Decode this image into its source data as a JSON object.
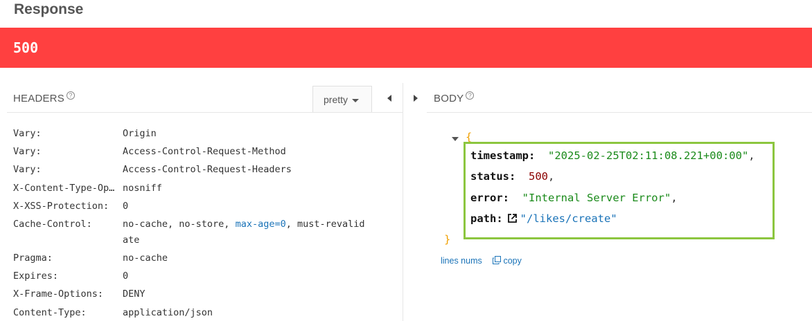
{
  "response": {
    "title": "Response",
    "status_code": "500"
  },
  "headers_panel": {
    "label": "HEADERS",
    "help_glyph": "?",
    "format_select": "pretty",
    "rows": [
      {
        "name": "Vary:",
        "value": "Origin"
      },
      {
        "name": "Vary:",
        "value": "Access-Control-Request-Method"
      },
      {
        "name": "Vary:",
        "value": "Access-Control-Request-Headers"
      },
      {
        "name": "X-Content-Type-Op…",
        "value": "nosniff"
      },
      {
        "name": "X-XSS-Protection:",
        "value": "0"
      },
      {
        "name": "Cache-Control:",
        "value_parts": [
          "no-cache, no-store, ",
          "max-age=0",
          ", must-revalid"
        ],
        "value_cont": "ate"
      },
      {
        "name": "Pragma:",
        "value": "no-cache"
      },
      {
        "name": "Expires:",
        "value": "0"
      },
      {
        "name": "X-Frame-Options:",
        "value": "DENY"
      },
      {
        "name": "Content-Type:",
        "value": "application/json"
      }
    ]
  },
  "body_panel": {
    "label": "BODY",
    "help_glyph": "?",
    "open_brace": "{",
    "close_brace": "}",
    "fields": [
      {
        "key": "timestamp:",
        "value": "\"2025-02-25T02:11:08.221+00:00\"",
        "trail": ","
      },
      {
        "key": "status:",
        "value": "500",
        "trail": ","
      },
      {
        "key": "error:",
        "value": "\"Internal Server Error\"",
        "trail": ","
      },
      {
        "key": "path:",
        "value": "\"/likes/create\"",
        "trail": ""
      }
    ],
    "lines_nums_label": "lines nums",
    "copy_label": "copy"
  },
  "colors": {
    "status_bar": "#ff4040",
    "highlight_box": "#8cc63f",
    "string": "#1a8a1a",
    "number": "#8b0000",
    "link": "#1a73b8",
    "brace": "#f0a000"
  },
  "icons": [
    "help-icon",
    "caret-down-icon",
    "collapse-left-icon",
    "expand-right-icon",
    "collapse-triangle-icon",
    "external-link-icon",
    "copy-icon"
  ]
}
